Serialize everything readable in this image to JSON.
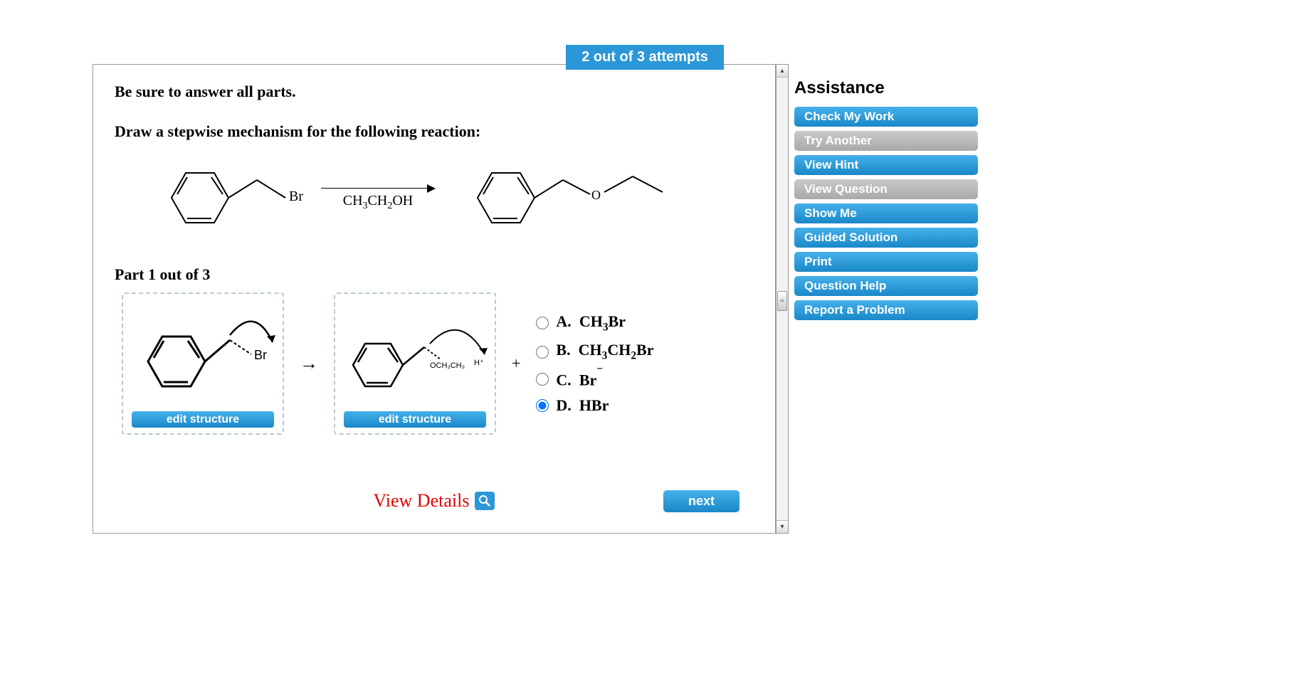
{
  "attempts": "2 out of 3 attempts",
  "instruction": "Be sure to answer all parts.",
  "prompt": "Draw a stepwise mechanism for the following reaction:",
  "reactant_label": "Br",
  "reagent_html": "CH3CH2OH",
  "part_label": "Part 1 out of 3",
  "drawbox1": {
    "sub_label": "Br",
    "button": "edit structure"
  },
  "drawbox2": {
    "sub_label": "OCH2CH3",
    "charge": "H+",
    "button": "edit structure"
  },
  "plus": "+",
  "choices": [
    {
      "key": "A.",
      "formula": "CH3Br",
      "selected": false
    },
    {
      "key": "B.",
      "formula": "CH3CH2Br",
      "selected": false
    },
    {
      "key": "C.",
      "formula": "Br−",
      "selected": false
    },
    {
      "key": "D.",
      "formula": "HBr",
      "selected": true
    }
  ],
  "view_details": "View Details",
  "next": "next",
  "assistance": {
    "title": "Assistance",
    "buttons": [
      {
        "label": "Check My Work",
        "enabled": true
      },
      {
        "label": "Try Another",
        "enabled": false
      },
      {
        "label": "View Hint",
        "enabled": true
      },
      {
        "label": "View Question",
        "enabled": false
      },
      {
        "label": "Show Me",
        "enabled": true
      },
      {
        "label": "Guided Solution",
        "enabled": true
      },
      {
        "label": "Print",
        "enabled": true
      },
      {
        "label": "Question Help",
        "enabled": true
      },
      {
        "label": "Report a Problem",
        "enabled": true
      }
    ]
  }
}
